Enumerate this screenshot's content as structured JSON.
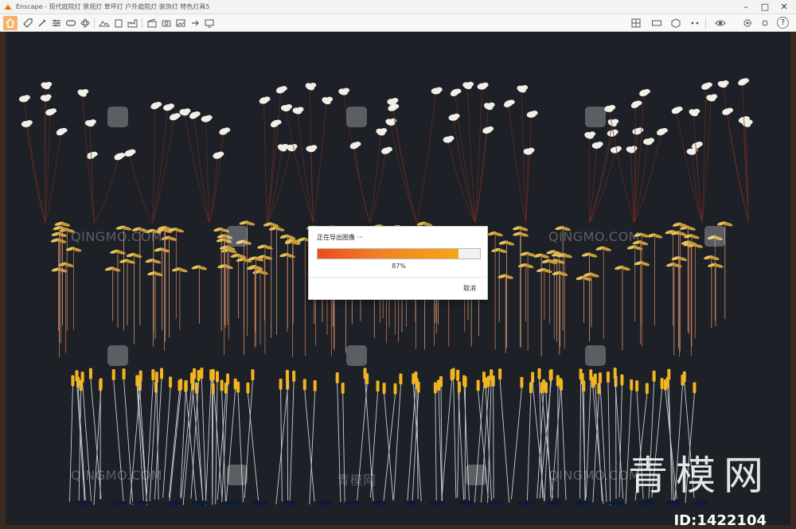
{
  "window": {
    "title": "Enscape - 现代庭院灯 景观灯 草坪灯 户外庭院灯 装饰灯 特色灯具5",
    "minimize_icon": "minimize-icon",
    "maximize_icon": "maximize-icon",
    "close_icon": "close-icon"
  },
  "toolbar": {
    "left_icons": [
      "home-icon",
      "tag-icon",
      "brush-icon",
      "sliders-icon",
      "gamepad-icon",
      "atom-icon",
      "landscape-icon",
      "building-icon",
      "factory-icon",
      "clapper-icon",
      "camera-icon",
      "image-icon",
      "export-icon",
      "screen-icon",
      "video-icon"
    ],
    "right_icons": [
      "grid-icon",
      "panorama-icon",
      "cube-icon",
      "dots-icon",
      "eye-icon",
      "settings-icon",
      "help-icon"
    ],
    "help_label": "?"
  },
  "export_dialog": {
    "title": "正在导出图像 ···",
    "progress": 0.87,
    "progress_text": "87%",
    "cancel_label": "取消"
  },
  "watermarks": {
    "site_text": "QINGMO.COM",
    "cn_small": "青模网",
    "brand_cn": "青模网",
    "id_text": "ID:1422104"
  },
  "colors": {
    "accent_orange": "#f38224",
    "viewport_bg": "#1d2026",
    "flower": "#f2efe6",
    "leaf_gold": "#e6c25a",
    "reed_head": "#f2b521",
    "stem_red": "#c07a5a"
  }
}
